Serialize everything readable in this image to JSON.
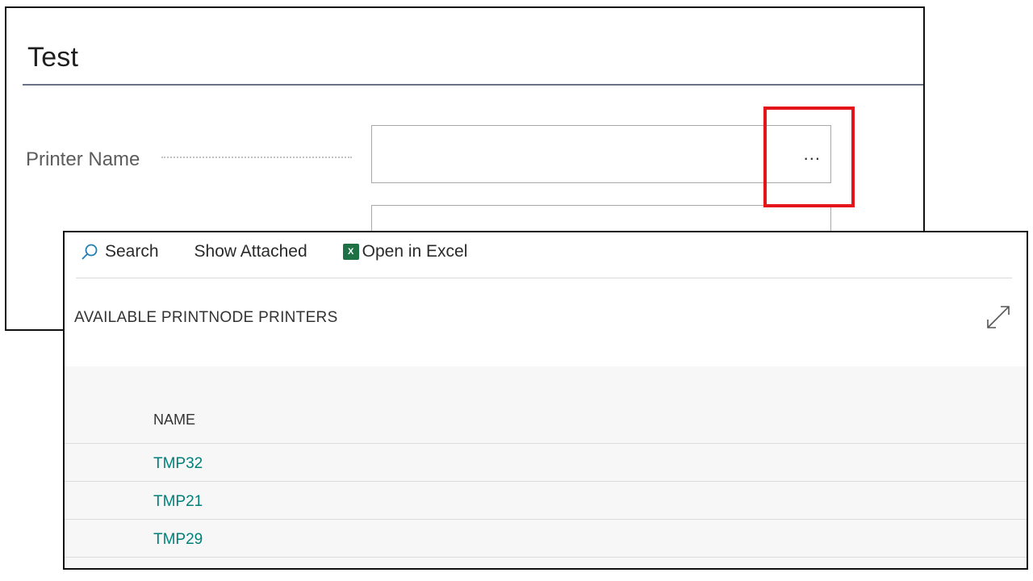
{
  "back_card": {
    "title": "Test",
    "field_label": "Printer Name",
    "field_value": "",
    "lookup_button": "..."
  },
  "lookup": {
    "toolbar": {
      "search": "Search",
      "show_attached": "Show Attached",
      "open_in_excel": "Open in Excel"
    },
    "list_title": "AVAILABLE PRINTNODE PRINTERS",
    "column_header": "NAME",
    "rows": [
      "TMP32",
      "TMP21",
      "TMP29"
    ]
  },
  "icons": {
    "search": "search-icon",
    "excel": "excel-icon",
    "expand": "expand-icon"
  },
  "colors": {
    "highlight": "#e3141a",
    "link": "#00807a",
    "excel_green": "#1e7145"
  }
}
